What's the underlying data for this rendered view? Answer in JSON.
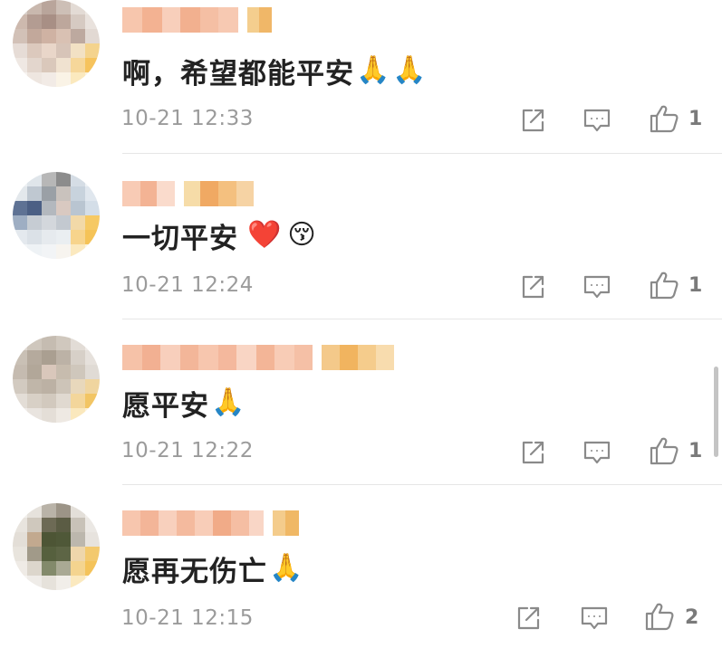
{
  "comments": [
    {
      "text": "啊，希望都能平安",
      "emojis": [
        "🙏",
        "🙏"
      ],
      "time": "10-21 12:33",
      "likes": "1"
    },
    {
      "text": "一切平安",
      "emojis": [
        "❤️",
        "😚"
      ],
      "time": "10-21 12:24",
      "likes": "1"
    },
    {
      "text": "愿平安",
      "emojis": [
        "🙏"
      ],
      "time": "10-21 12:22",
      "likes": "1"
    },
    {
      "text": "愿再无伤亡",
      "emojis": [
        "🙏"
      ],
      "time": "10-21 12:15",
      "likes": "2"
    }
  ],
  "icons": {
    "share": "share-icon",
    "comment": "comment-icon",
    "like": "thumbs-up-icon"
  },
  "colors": {
    "time_text": "#9b9b9b",
    "icon_gray": "#8a8a8a",
    "divider": "#e6e6e6"
  }
}
